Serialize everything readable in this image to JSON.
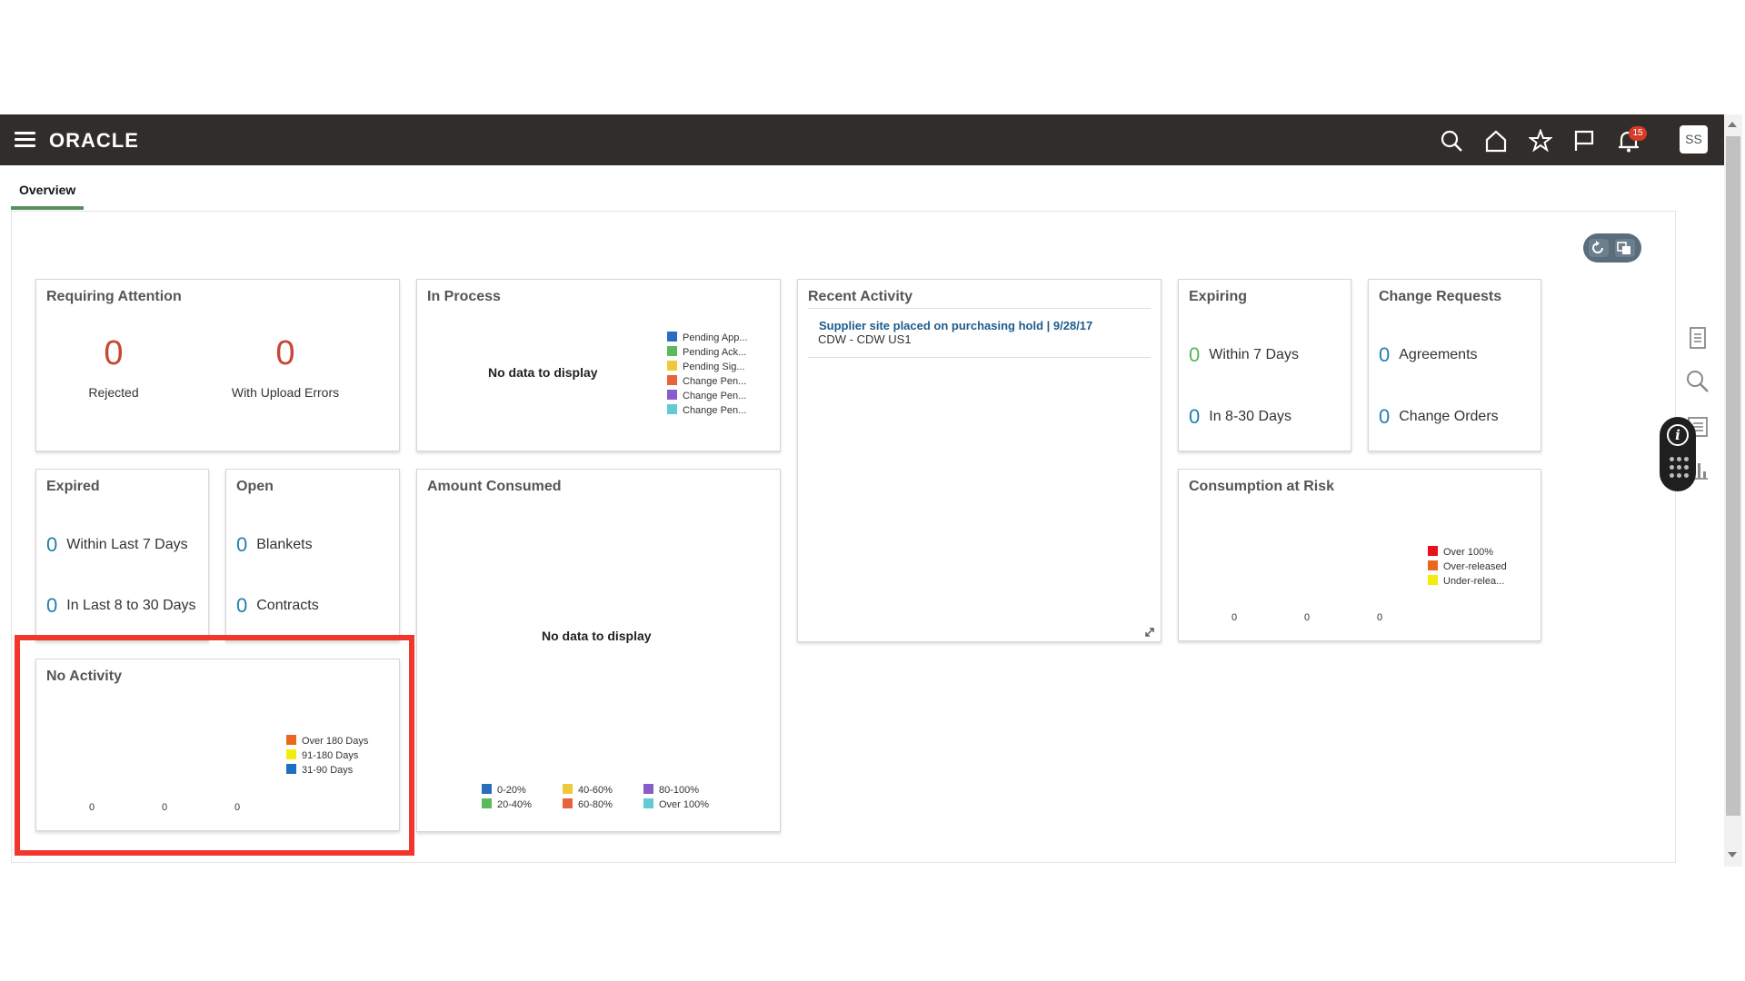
{
  "app": {
    "logo": "ORACLE",
    "avatar": "SS",
    "notification_count": "15"
  },
  "tabs": [
    {
      "label": "Overview"
    }
  ],
  "colors": {
    "header_bg": "#312d2a",
    "alert_number": "#c74634",
    "link_number": "#227fb0",
    "green_number": "#58b35d",
    "highlight_border": "#f2362c"
  },
  "cards": {
    "requiring_attention": {
      "title": "Requiring Attention",
      "items": [
        {
          "value": "0",
          "label": "Rejected"
        },
        {
          "value": "0",
          "label": "With Upload Errors"
        }
      ]
    },
    "in_process": {
      "title": "In Process",
      "no_data": "No data to display",
      "legend": [
        {
          "label": "Pending App...",
          "color": "#2a6ebb"
        },
        {
          "label": "Pending Ack...",
          "color": "#5cb85c"
        },
        {
          "label": "Pending Sig...",
          "color": "#f0c93a"
        },
        {
          "label": "Change Pen...",
          "color": "#e8623a"
        },
        {
          "label": "Change Pen...",
          "color": "#8a5cc9"
        },
        {
          "label": "Change Pen...",
          "color": "#62cad4"
        }
      ]
    },
    "recent_activity": {
      "title": "Recent Activity",
      "link": "Supplier site placed on purchasing hold | 9/28/17",
      "sub": "CDW - CDW US1"
    },
    "expiring": {
      "title": "Expiring",
      "items": [
        {
          "value": "0",
          "label": "Within 7 Days"
        },
        {
          "value": "0",
          "label": "In 8-30 Days"
        }
      ]
    },
    "change_requests": {
      "title": "Change Requests",
      "items": [
        {
          "value": "0",
          "label": "Agreements"
        },
        {
          "value": "0",
          "label": "Change Orders"
        }
      ]
    },
    "expired": {
      "title": "Expired",
      "items": [
        {
          "value": "0",
          "label": "Within Last 7 Days"
        },
        {
          "value": "0",
          "label": "In Last 8 to 30 Days"
        }
      ]
    },
    "open": {
      "title": "Open",
      "items": [
        {
          "value": "0",
          "label": "Blankets"
        },
        {
          "value": "0",
          "label": "Contracts"
        }
      ]
    },
    "amount_consumed": {
      "title": "Amount Consumed",
      "no_data": "No data to display",
      "legend": [
        {
          "label": "0-20%",
          "color": "#2a6ebb"
        },
        {
          "label": "20-40%",
          "color": "#5cb85c"
        },
        {
          "label": "40-60%",
          "color": "#f0c93a"
        },
        {
          "label": "60-80%",
          "color": "#e8623a"
        },
        {
          "label": "80-100%",
          "color": "#8a5cc9"
        },
        {
          "label": "Over 100%",
          "color": "#62cad4"
        }
      ]
    },
    "consumption_at_risk": {
      "title": "Consumption at Risk",
      "axis_values": [
        "0",
        "0",
        "0"
      ],
      "legend": [
        {
          "label": "Over 100%",
          "color": "#e8111e"
        },
        {
          "label": "Over-released",
          "color": "#e8691e"
        },
        {
          "label": "Under-relea...",
          "color": "#f2ec0f"
        }
      ]
    },
    "no_activity": {
      "title": "No Activity",
      "axis_values": [
        "0",
        "0",
        "0"
      ],
      "legend": [
        {
          "label": "Over 180 Days",
          "color": "#e8691e"
        },
        {
          "label": "91-180 Days",
          "color": "#f2ec0f"
        },
        {
          "label": "31-90 Days",
          "color": "#1e6fc2"
        }
      ]
    }
  },
  "icons": {
    "toolbar": [
      "search-icon",
      "home-icon",
      "star-icon",
      "flag-icon",
      "bell-icon"
    ],
    "side_rail": [
      "document-icon",
      "magnifier-icon",
      "list-icon",
      "bar-chart-icon"
    ],
    "floating": [
      "info-icon",
      "keypad-icon"
    ]
  }
}
